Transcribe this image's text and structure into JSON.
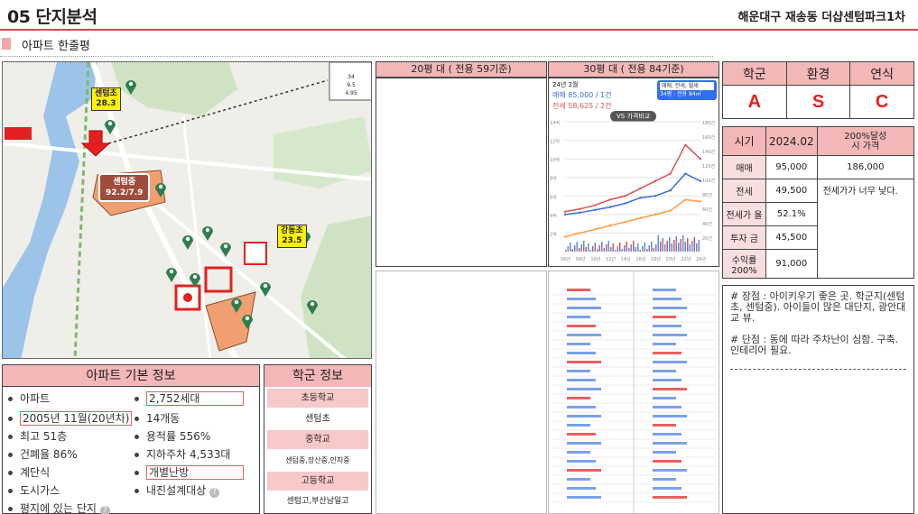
{
  "header": {
    "title": "05 단지분석",
    "subtitle": "해운대구 재송동 더샵센텀파크1차"
  },
  "section": {
    "label": "아파트 한줄평"
  },
  "map": {
    "labels": {
      "school1": {
        "name": "센텀초",
        "value": "28.3"
      },
      "school2": {
        "name": "센텀중",
        "value": "92.2/7.9"
      },
      "school3": {
        "name": "강동초",
        "value": "23.5"
      }
    },
    "callout_rows": [
      "34",
      "9.5",
      "4.95"
    ]
  },
  "basic_info": {
    "title": "아파트 기본 정보",
    "items": [
      "아파트",
      "2,752세대",
      "2005년 11월(20년차)",
      "14개동",
      "최고 51층",
      "용적률 556%",
      "건폐율 86%",
      "지하주차 4,533대",
      "계단식",
      "개별난방",
      "도시가스",
      "내진설계대상",
      "평지에 있는 단지"
    ]
  },
  "school_info": {
    "title": "학군 정보",
    "rows": [
      "초등학교",
      "센텀초",
      "중학교",
      "센텀중,장산중,인지중",
      "고등학교",
      "센텀고,부산남일고"
    ]
  },
  "pyeong": {
    "py20": "20평 대 ( 전용 59기준)",
    "py30": "30평 대 ( 전용 84기준)"
  },
  "py30_chart": {
    "date": "24년 2월",
    "sale": "매매 85,000 / 1건",
    "jeonse": "전세 58,625 / 2건",
    "compare": "VS 가격비교",
    "filter": "매매, 전세, 월세",
    "size": "34평 : 전용 84㎡",
    "y_ticks": [
      "14억",
      "12억",
      "10억",
      "8억",
      "6억",
      "4억",
      "2억"
    ],
    "y2_ticks": [
      "180건",
      "160건",
      "140건",
      "120건",
      "100건",
      "80건",
      "60건",
      "40건",
      "20건"
    ],
    "x_ticks": [
      "06년",
      "08년",
      "10년",
      "12년",
      "14년",
      "16년",
      "18년",
      "20년",
      "22년",
      "24년"
    ]
  },
  "chart_data": {
    "type": "line",
    "x": [
      "06년",
      "08년",
      "10년",
      "12년",
      "14년",
      "16년",
      "18년",
      "20년",
      "22년",
      "24년"
    ],
    "series": [
      {
        "color": "#e05050",
        "values": [
          4.3,
          4.6,
          5.0,
          5.6,
          6.0,
          6.8,
          7.6,
          8.4,
          11.5,
          10.0
        ]
      },
      {
        "color": "#3a6fd8",
        "values": [
          4.0,
          4.2,
          4.5,
          4.8,
          5.2,
          5.8,
          6.0,
          6.6,
          8.4,
          7.6
        ]
      },
      {
        "color": "#ff9a40",
        "values": [
          1.6,
          2.0,
          2.4,
          2.8,
          3.2,
          3.6,
          4.0,
          4.4,
          5.6,
          5.4
        ]
      }
    ],
    "ylim": [
      0,
      14
    ]
  },
  "ratings": {
    "headers": [
      "학군",
      "환경",
      "연식"
    ],
    "values": [
      "A",
      "S",
      "C"
    ]
  },
  "price": {
    "headers": [
      "시기",
      "2024.02",
      "200%달성\n시 가격"
    ],
    "rows": [
      {
        "label": "매매",
        "value": "95,000",
        "extra": "186,000"
      },
      {
        "label": "전세",
        "value": "49,500",
        "extra": "전세가가 너무 낮다."
      },
      {
        "label": "전세가 율",
        "value": "52.1%",
        "extra": ""
      },
      {
        "label": "투자 금",
        "value": "45,500",
        "extra": ""
      },
      {
        "label": "수익률 200%",
        "value": "91,000",
        "extra": ""
      }
    ]
  },
  "notes": {
    "pros": "# 장점 : 아이키우기 좋은 곳. 학군지(센텀초, 센텀중). 아이들이 많은 대단지, 광안대교 뷰.",
    "cons": "# 단점 : 동에 따라 주차난이 심함. 구축. 인테리어 필요."
  }
}
